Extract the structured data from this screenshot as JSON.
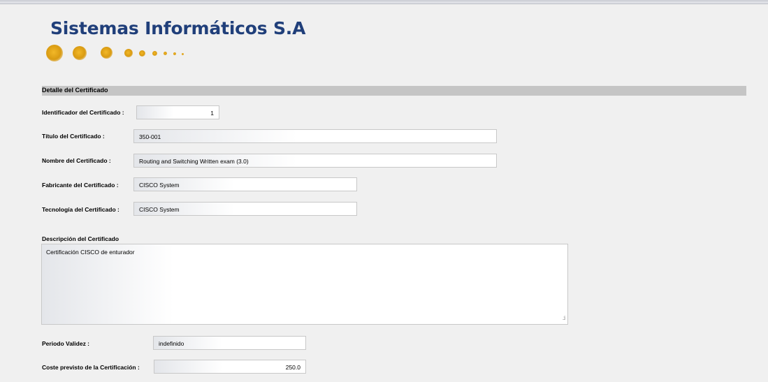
{
  "brand": {
    "name": "Sistemas Informáticos S.A"
  },
  "section": {
    "title": "Detalle del Certificado"
  },
  "fields": {
    "id": {
      "label": "Identificador del Certificado :",
      "value": "1"
    },
    "titulo": {
      "label": "Título del Certificado :",
      "value": "350-001"
    },
    "nombre": {
      "label": "Nombre del Certificado :",
      "value": "Routing and Switching Written exam (3.0)"
    },
    "fabricante": {
      "label": "Fabricante del Certificado :",
      "value": "CISCO System"
    },
    "tecnologia": {
      "label": "Tecnología del Certificado :",
      "value": "CISCO System"
    },
    "descripcion": {
      "label": "Descripción del Certificado",
      "value": "Certificación CISCO de enturador"
    },
    "periodo": {
      "label": "Periodo Validez :",
      "value": "indefinido"
    },
    "coste": {
      "label": "Coste previsto de la Certificación :",
      "value": "250.0"
    }
  },
  "icons": {
    "logo_dots": "logo-dots-icon",
    "resize_grip": "resize-grip-icon"
  },
  "colors": {
    "brand": "#203f7a",
    "accent": "#d99b12",
    "section_bar": "#c5c5c5"
  }
}
